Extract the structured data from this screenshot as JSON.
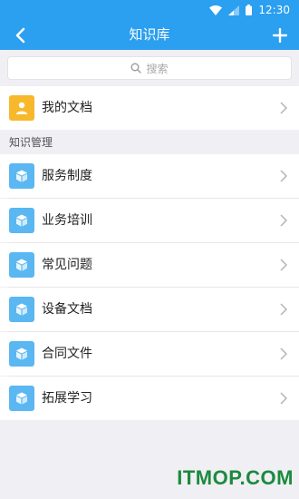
{
  "status_bar": {
    "time": "12:30"
  },
  "app_bar": {
    "title": "知识库"
  },
  "search": {
    "placeholder": "搜索"
  },
  "my_docs": {
    "label": "我的文档",
    "icon": "user-icon",
    "color": "#f7b82c"
  },
  "section": {
    "title": "知识管理"
  },
  "categories": [
    {
      "label": "服务制度",
      "icon": "cube-icon"
    },
    {
      "label": "业务培训",
      "icon": "cube-icon"
    },
    {
      "label": "常见问题",
      "icon": "cube-icon"
    },
    {
      "label": "设备文档",
      "icon": "cube-icon"
    },
    {
      "label": "合同文件",
      "icon": "cube-icon"
    },
    {
      "label": "拓展学习",
      "icon": "cube-icon"
    }
  ],
  "colors": {
    "accent": "#2b9ff0",
    "category_icon": "#5ab7f2",
    "background": "#efeff4"
  },
  "watermark": {
    "text": "ITMOP.COM"
  }
}
